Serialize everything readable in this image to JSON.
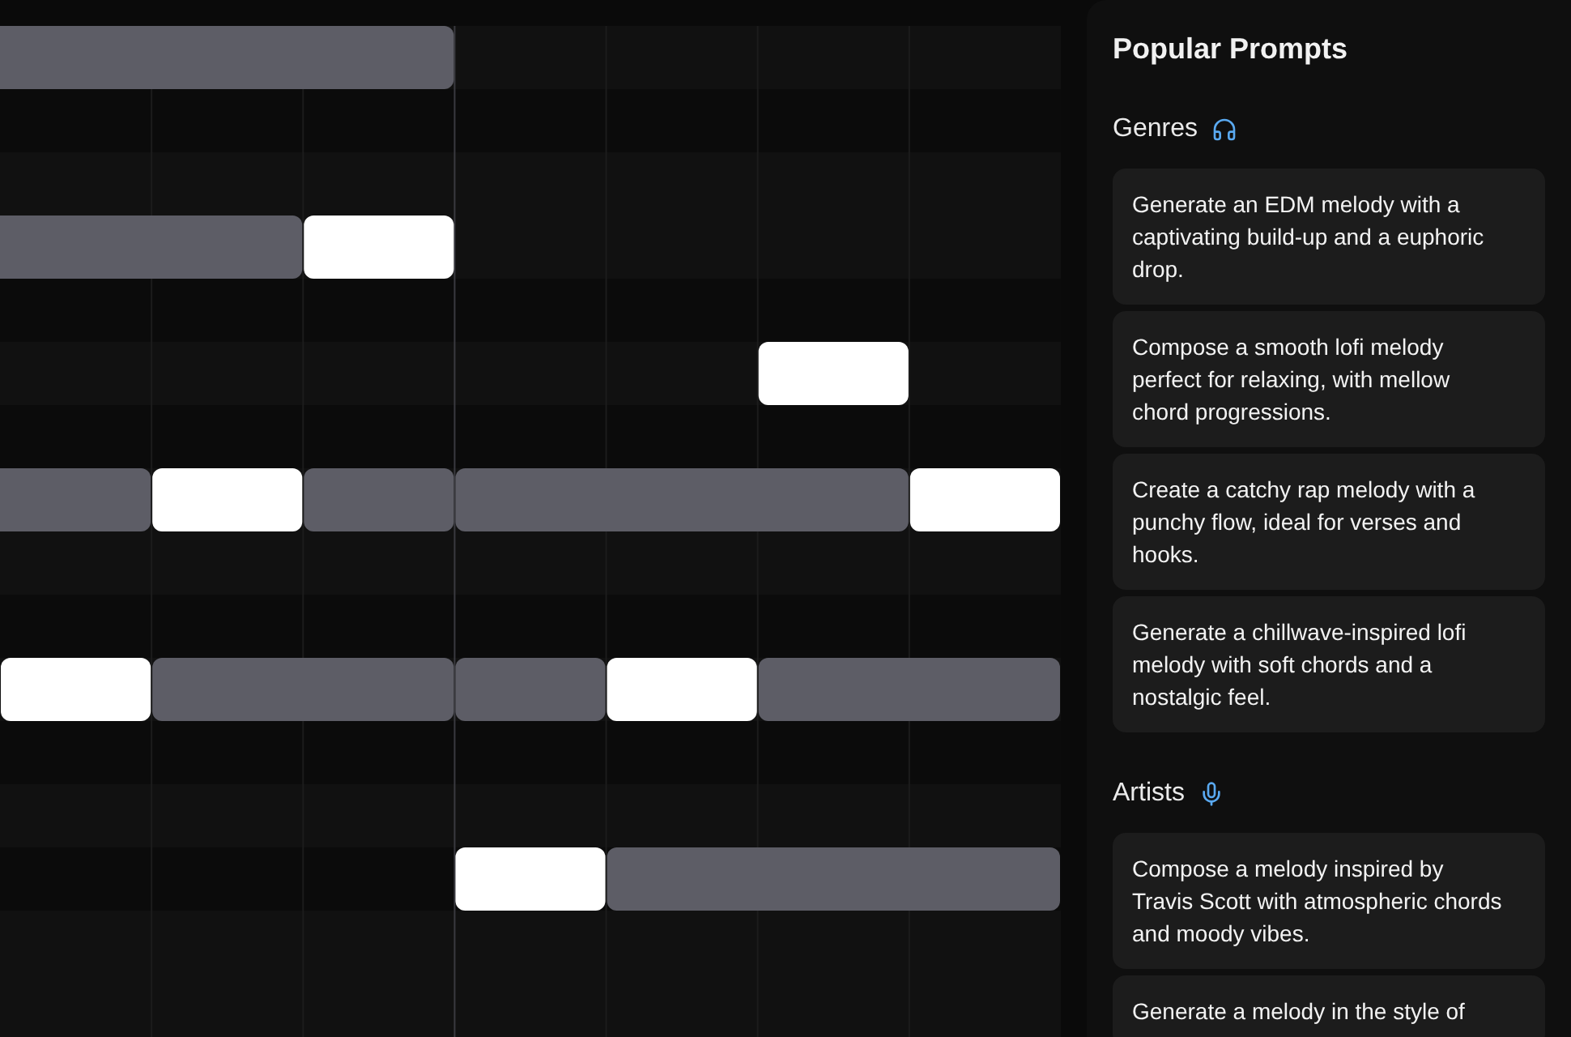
{
  "sidebar": {
    "title": "Popular Prompts",
    "sections": [
      {
        "title": "Genres",
        "prompts": [
          "Generate an EDM melody with a captivating build-up and a euphoric drop.",
          "Compose a smooth lofi melody perfect for relaxing, with mellow chord progressions.",
          "Create a catchy rap melody with a punchy flow, ideal for verses and hooks.",
          "Generate a chillwave-inspired lofi melody with soft chords and a nostalgic feel."
        ]
      },
      {
        "title": "Artists",
        "prompts": [
          "Compose a melody inspired by Travis Scott with atmospheric chords and moody vibes.",
          "Generate a melody in the style of"
        ]
      }
    ]
  }
}
